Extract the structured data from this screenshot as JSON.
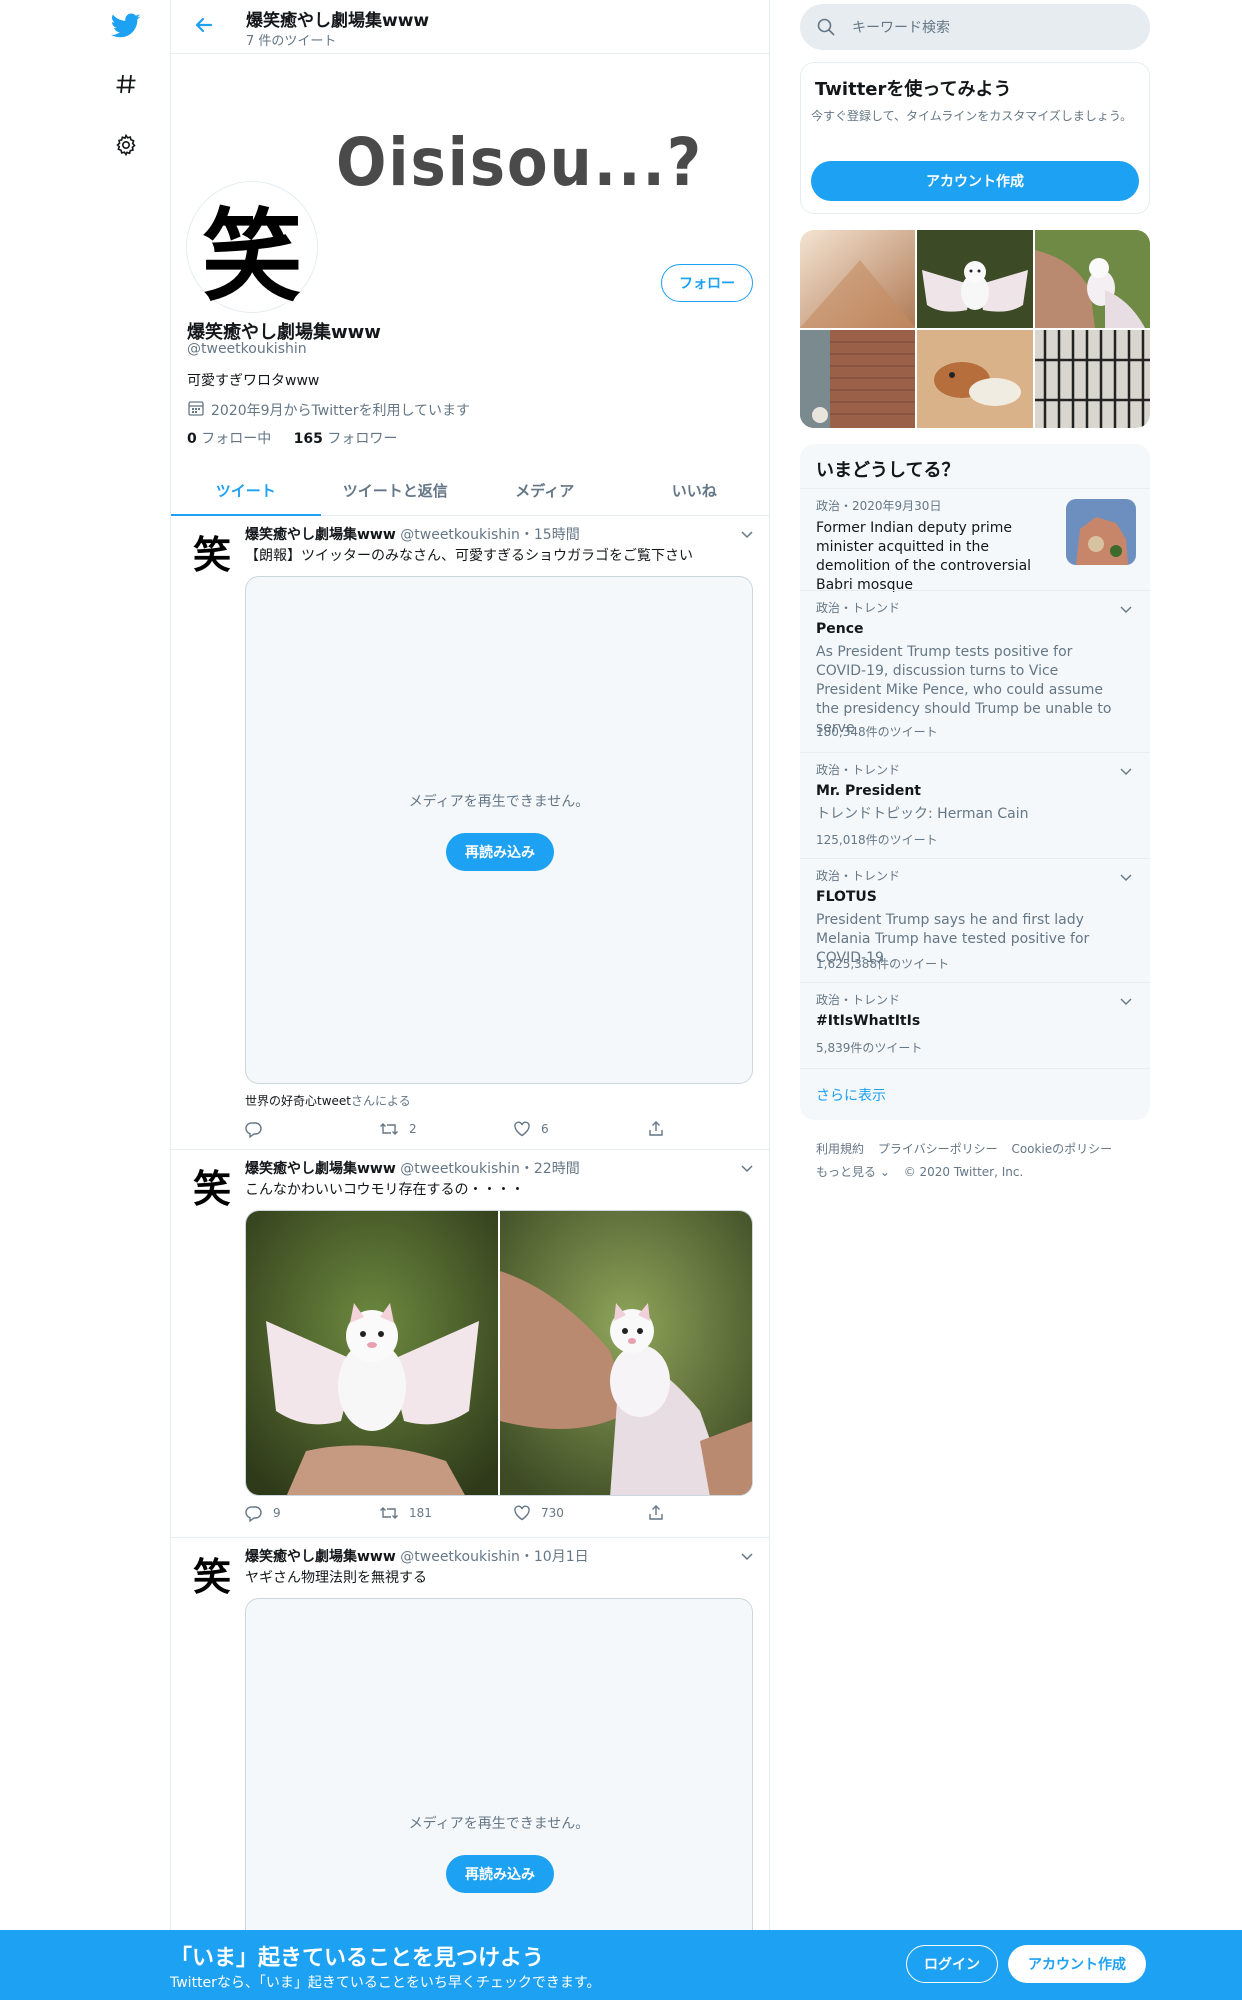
{
  "nav": {
    "icons": [
      "twitter-bird-icon",
      "hashtag-icon",
      "gear-icon"
    ]
  },
  "header": {
    "title": "爆笑癒やし劇場集www",
    "subtitle": "7 件のツイート"
  },
  "profile": {
    "banner_text": "Oisisou...?",
    "avatar_char": "笑",
    "follow_label": "フォロー",
    "name": "爆笑癒やし劇場集www",
    "handle": "@tweetkoukishin",
    "bio": "可愛すぎワロタwww",
    "joined": "2020年9月からTwitterを利用しています",
    "following_count": "0",
    "following_label": "フォロー中",
    "followers_count": "165",
    "followers_label": "フォロワー"
  },
  "tabs": [
    "ツイート",
    "ツイートと返信",
    "メディア",
    "いいね"
  ],
  "tweets": [
    {
      "avatar_char": "笑",
      "name": "爆笑癒やし劇場集www",
      "meta": "@tweetkoukishin・15時間",
      "text": "【朗報】ツイッターのみなさん、可愛すぎるショウガラゴをご覧下さい",
      "media_msg": "メディアを再生できません。",
      "reload_label": "再読み込み",
      "credit_name": "世界の好奇心tweet",
      "credit_suffix": "さんによる",
      "replies": "",
      "retweets": "2",
      "likes": "6"
    },
    {
      "avatar_char": "笑",
      "name": "爆笑癒やし劇場集www",
      "meta": "@tweetkoukishin・22時間",
      "text": "こんなかわいいコウモリ存在するの・・・・",
      "replies": "9",
      "retweets": "181",
      "likes": "730"
    },
    {
      "avatar_char": "笑",
      "name": "爆笑癒やし劇場集www",
      "meta": "@tweetkoukishin・10月1日",
      "text": "ヤギさん物理法則を無視する",
      "media_msg": "メディアを再生できません。",
      "reload_label": "再読み込み"
    }
  ],
  "sidebar": {
    "search_placeholder": "キーワード検索",
    "signup_title": "Twitterを使ってみよう",
    "signup_text": "今すぐ登録して、タイムラインをカスタマイズしましょう。",
    "signup_button": "アカウント作成",
    "trends_title": "いまどうしてる？",
    "trends": [
      {
        "category": "政治・2020年9月30日",
        "name": "Former Indian deputy prime minister acquitted in the demolition of the controversial Babri mosque"
      },
      {
        "category": "政治・トレンド",
        "name": "Pence",
        "desc": "As President Trump tests positive for COVID-19, discussion turns to Vice President Mike Pence, who could assume the presidency should Trump be unable to serve",
        "count": "180,348件のツイート"
      },
      {
        "category": "政治・トレンド",
        "name": "Mr. President",
        "desc": "トレンドトピック: Herman Cain",
        "count": "125,018件のツイート"
      },
      {
        "category": "政治・トレンド",
        "name": "FLOTUS",
        "desc": "President Trump says he and first lady Melania Trump have tested positive for COVID-19",
        "count": "1,625,388件のツイート"
      },
      {
        "category": "政治・トレンド",
        "name": "#ItIsWhatItIs",
        "count": "5,839件のツイート"
      }
    ],
    "show_more": "さらに表示",
    "footer": [
      "利用規約",
      "プライバシーポリシー",
      "Cookieのポリシー",
      "もっと見る ⌄",
      "© 2020 Twitter, Inc."
    ]
  },
  "bottom_bar": {
    "title": "「いま」起きていることを見つけよう",
    "subtitle": "Twitterなら、「いま」起きていることをいち早くチェックできます。",
    "login": "ログイン",
    "signup": "アカウント作成"
  }
}
